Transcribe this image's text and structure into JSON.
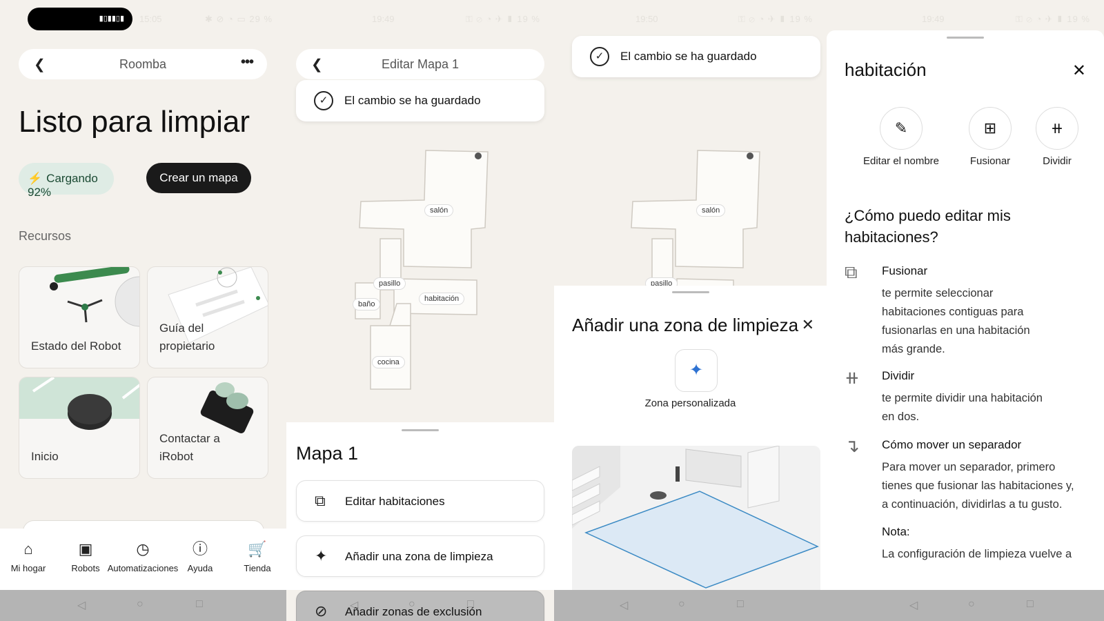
{
  "panel1": {
    "status_time": "15:05",
    "status_icons": "✱ ⊘ ◔ ▭ 29 %",
    "title": "Roomba",
    "heading": "Listo para limpiar",
    "charging": "Cargando 92%",
    "create_map": "Crear un mapa",
    "resources": "Recursos",
    "cards": [
      {
        "label_line1": "Estado del Robot",
        "label_line2": ""
      },
      {
        "label_line1": "Guía del",
        "label_line2": "propietario"
      },
      {
        "label_line1": "Inicio",
        "label_line2": ""
      },
      {
        "label_line1": "Contactar a",
        "label_line2": "iRobot"
      }
    ],
    "nav": [
      {
        "label": "Mi hogar",
        "icon": "home-icon"
      },
      {
        "label": "Robots",
        "icon": "robot-icon"
      },
      {
        "label": "Automatizaciones",
        "icon": "clock-icon"
      },
      {
        "label": "Ayuda",
        "icon": "help-icon"
      },
      {
        "label": "Tienda",
        "icon": "cart-icon"
      }
    ]
  },
  "panel2": {
    "status_time": "19:49",
    "status_icons": "⚿ ⊘ ◔ ✈ ▮ 19 %",
    "title": "Editar Mapa 1",
    "toast": "El cambio se ha guardado",
    "rooms": [
      "salón",
      "pasillo",
      "baño",
      "habitación",
      "cocina"
    ],
    "sheet_title": "Mapa 1",
    "options": [
      "Editar habitaciones",
      "Añadir una zona de limpieza",
      "Añadir zonas de exclusión"
    ]
  },
  "panel3": {
    "status_time": "19:50",
    "status_icons": "⚿ ⊘ ◔ ✈ ▮ 19 %",
    "toast": "El cambio se ha guardado",
    "rooms": [
      "salón",
      "pasillo"
    ],
    "sheet_title": "Añadir una zona de limpieza",
    "zone_label": "Zona personalizada"
  },
  "panel4": {
    "status_time": "19:49",
    "status_icons": "⚿ ⊘ ◔ ✈ ▮ 19 %",
    "title": "habitación",
    "actions": [
      "Editar el nombre",
      "Fusionar",
      "Dividir"
    ],
    "question": "¿Cómo puedo editar mis habitaciones?",
    "help": [
      {
        "title": "Fusionar",
        "lines": [
          "te permite seleccionar",
          "habitaciones contiguas para",
          "fusionarlas en una habitación",
          "más grande."
        ]
      },
      {
        "title": "Dividir",
        "lines": [
          "te permite dividir una habitación",
          "en dos."
        ]
      },
      {
        "title": "Cómo mover un separador",
        "lines": [
          "Para mover un separador, primero",
          "tienes que fusionar las habitaciones y,",
          "a continuación, dividirlas a tu gusto."
        ]
      },
      {
        "title": "Nota:",
        "lines": [
          "La configuración de limpieza vuelve a"
        ]
      }
    ]
  },
  "colors": {
    "accent_green": "#dfece5",
    "dark_button": "#1a1a1a",
    "zone_blue": "#2e72d2"
  }
}
